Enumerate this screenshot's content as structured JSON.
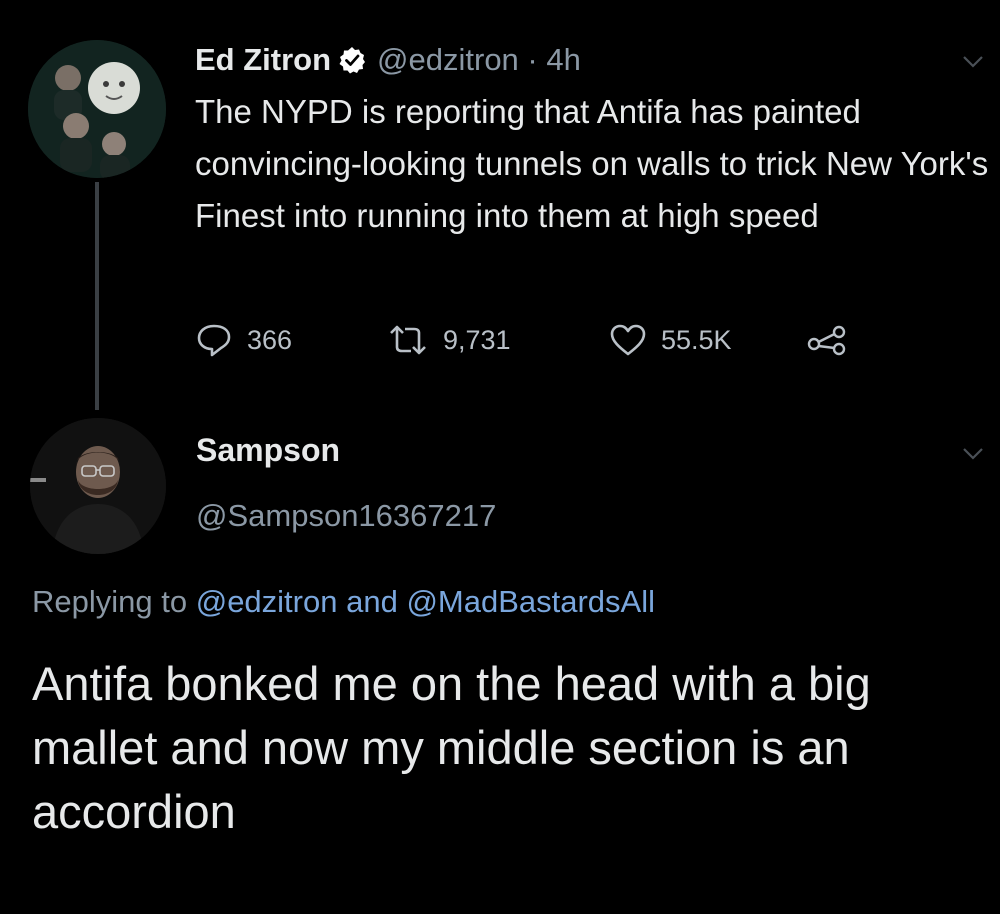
{
  "tweet": {
    "author_name": "Ed Zitron",
    "handle_time": "@edzitron · 4h",
    "verified": true,
    "text": "The NYPD is reporting that Antifa has painted convincing-looking tunnels on walls to trick New York's Finest into running into them at high speed",
    "stats": {
      "replies": "366",
      "retweets": "9,731",
      "likes": "55.5K"
    },
    "icons": [
      "verified-badge-icon",
      "chevron-down-icon",
      "reply-icon",
      "retweet-icon",
      "like-icon",
      "share-icon"
    ]
  },
  "reply": {
    "author_name": "Sampson",
    "handle": "@Sampson16367217",
    "replying_prefix": "Replying to ",
    "replying_mention_1": "@edzitron",
    "replying_and": " and ",
    "replying_mention_2": "@MadBastardsAll",
    "text": "Antifa bonked me on the head with a big mallet and now my middle section is an accordion"
  },
  "colors": {
    "background": "#000000",
    "primary_text": "#e7e9ea",
    "secondary_text": "#8b98a5",
    "link": "#7aa6dc",
    "verified": "#ffffff"
  }
}
